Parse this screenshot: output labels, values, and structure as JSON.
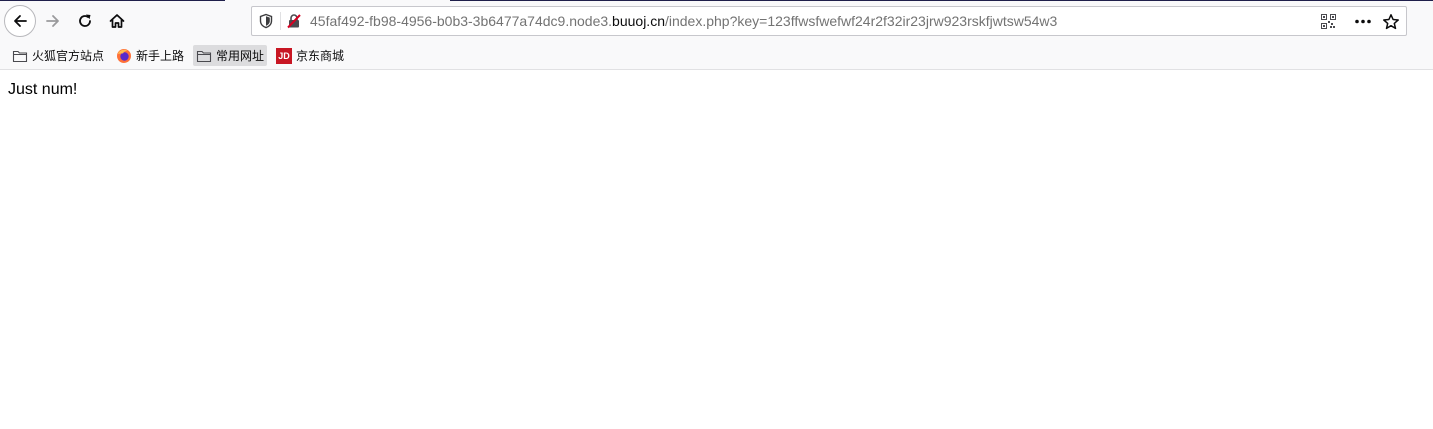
{
  "browser": {
    "url": {
      "prefix": "45faf492-fb98-4956-b0b3-3b6477a74dc9.node3.",
      "domain": "buuoj.cn",
      "suffix": "/index.php?key=123ffwsfwefwf24r2f32ir23jrw923rskfjwtsw54w3"
    },
    "toolbar_icons": [
      "back-arrow-icon",
      "forward-arrow-icon",
      "reload-icon",
      "home-icon"
    ],
    "url_bar_icons": [
      "tracking-shield-icon",
      "insecure-lock-icon",
      "qr-code-icon",
      "more-icon",
      "bookmark-star-icon"
    ]
  },
  "bookmarks": [
    {
      "label": "火狐官方站点",
      "icon": "folder-icon"
    },
    {
      "label": "新手上路",
      "icon": "firefox-icon"
    },
    {
      "label": "常用网址",
      "icon": "folder-icon"
    },
    {
      "label": "京东商城",
      "icon": "jd-icon",
      "icon_text": "JD"
    }
  ],
  "page": {
    "text": "Just num!"
  },
  "colors": {
    "toolbar_bg": "#f9f9fa",
    "jd_red": "#c81623",
    "url_dim": "#737373",
    "url_domain": "#0c0c0d"
  }
}
